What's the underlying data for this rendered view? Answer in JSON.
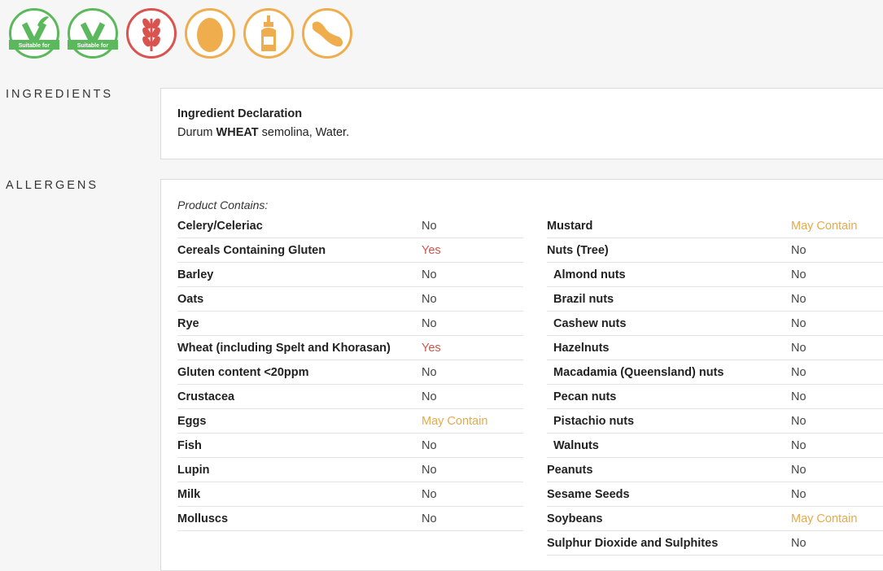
{
  "icons": [
    {
      "name": "vegetarian-icon",
      "color": "#5cb85c",
      "label": "Suitable for"
    },
    {
      "name": "vegan-icon",
      "color": "#5cb85c",
      "label": "Suitable for"
    },
    {
      "name": "gluten-wheat-icon",
      "color": "#d9534f"
    },
    {
      "name": "egg-icon",
      "color": "#f0ad4e"
    },
    {
      "name": "mustard-icon",
      "color": "#f0ad4e"
    },
    {
      "name": "soybean-icon",
      "color": "#f0ad4e"
    }
  ],
  "sections": {
    "ingredients_label": "INGREDIENTS",
    "allergens_label": "ALLERGENS"
  },
  "ingredients": {
    "title": "Ingredient Declaration",
    "text_prefix": "Durum ",
    "text_bold": "WHEAT",
    "text_suffix": " semolina, Water."
  },
  "allergens": {
    "heading": "Product Contains:",
    "left": [
      {
        "name": "Celery/Celeriac",
        "value": "No",
        "status": "no"
      },
      {
        "name": "Cereals Containing Gluten",
        "value": "Yes",
        "status": "yes"
      },
      {
        "name": "Barley",
        "value": "No",
        "status": "no"
      },
      {
        "name": "Oats",
        "value": "No",
        "status": "no"
      },
      {
        "name": "Rye",
        "value": "No",
        "status": "no"
      },
      {
        "name": "Wheat (including Spelt and Khorasan)",
        "value": "Yes",
        "status": "yes"
      },
      {
        "name": "Gluten content <20ppm",
        "value": "No",
        "status": "no"
      },
      {
        "name": "Crustacea",
        "value": "No",
        "status": "no"
      },
      {
        "name": "Eggs",
        "value": "May Contain",
        "status": "may"
      },
      {
        "name": "Fish",
        "value": "No",
        "status": "no"
      },
      {
        "name": "Lupin",
        "value": "No",
        "status": "no"
      },
      {
        "name": "Milk",
        "value": "No",
        "status": "no"
      },
      {
        "name": "Molluscs",
        "value": "No",
        "status": "no"
      }
    ],
    "right": [
      {
        "name": "Mustard",
        "value": "May Contain",
        "status": "may"
      },
      {
        "name": "Nuts (Tree)",
        "value": "No",
        "status": "no"
      },
      {
        "name": "Almond nuts",
        "value": "No",
        "status": "no",
        "sub": true
      },
      {
        "name": "Brazil nuts",
        "value": "No",
        "status": "no",
        "sub": true
      },
      {
        "name": "Cashew nuts",
        "value": "No",
        "status": "no",
        "sub": true
      },
      {
        "name": "Hazelnuts",
        "value": "No",
        "status": "no",
        "sub": true
      },
      {
        "name": "Macadamia (Queensland) nuts",
        "value": "No",
        "status": "no",
        "sub": true
      },
      {
        "name": "Pecan nuts",
        "value": "No",
        "status": "no",
        "sub": true
      },
      {
        "name": "Pistachio nuts",
        "value": "No",
        "status": "no",
        "sub": true
      },
      {
        "name": "Walnuts",
        "value": "No",
        "status": "no",
        "sub": true
      },
      {
        "name": "Peanuts",
        "value": "No",
        "status": "no"
      },
      {
        "name": "Sesame Seeds",
        "value": "No",
        "status": "no"
      },
      {
        "name": "Soybeans",
        "value": "May Contain",
        "status": "may"
      },
      {
        "name": "Sulphur Dioxide and Sulphites",
        "value": "No",
        "status": "no"
      }
    ]
  }
}
